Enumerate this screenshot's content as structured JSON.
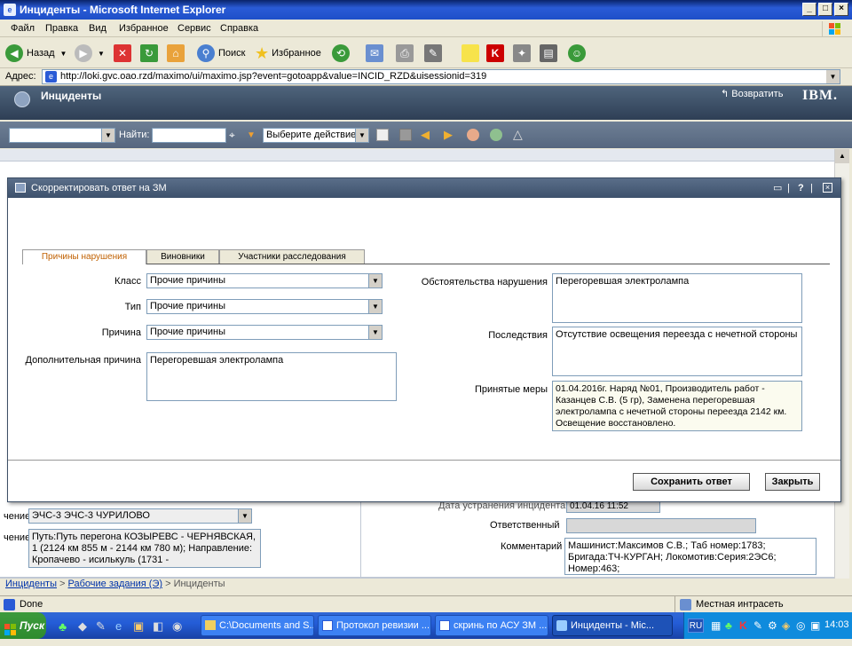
{
  "window": {
    "title": "Инциденты - Microsoft Internet Explorer"
  },
  "menu": [
    "Файл",
    "Правка",
    "Вид",
    "Избранное",
    "Сервис",
    "Справка"
  ],
  "toolbar": {
    "back": "Назад",
    "search": "Поиск",
    "favorites": "Избранное"
  },
  "address": {
    "label": "Адрес:",
    "url": "http://loki.gvc.oao.rzd/maximo/ui/maximo.jsp?event=gotoapp&value=INCID_RZD&uisessionid=319"
  },
  "app": {
    "title": "Инциденты",
    "return_label": "Возвратить",
    "brand": "IBM."
  },
  "apptoolbar": {
    "find_label": "Найти:",
    "action_placeholder": "Выберите действие"
  },
  "dialog": {
    "title": "Скорректировать ответ на ЗМ",
    "tabs": [
      "Причины нарушения",
      "Виновники",
      "Участники расследования"
    ],
    "left": {
      "class_label": "Класс",
      "class_value": "Прочие причины",
      "type_label": "Тип",
      "type_value": "Прочие причины",
      "reason_label": "Причина",
      "reason_value": "Прочие причины",
      "extra_label": "Дополнительная причина",
      "extra_value": "Перегоревшая электролампа"
    },
    "right": {
      "circ_label": "Обстоятельства нарушения",
      "circ_value": "Перегоревшая электролампа",
      "conseq_label": "Последствия",
      "conseq_value": "Отсутствие освещения переезда с нечетной стороны",
      "measures_label": "Принятые меры",
      "measures_value": "01.04.2016г. Наряд №01, Производитель работ - Казанцев С.В. (5 гр), Заменена перегоревшая электролампа с нечетной стороны переезда 2142 км. Освещение восстановлено."
    },
    "save_button": "Сохранить ответ",
    "close_button": "Закрыть"
  },
  "background": {
    "dept_label": "чение:",
    "dept_value": "ЭЧС-3 ЭЧС-3 ЧУРИЛОВО",
    "place_label": "чение:",
    "place_value": "Путь:Путь перегона КОЗЫРЕВС - ЧЕРНЯВСКАЯ, 1 (2124 км 855 м - 2144 км 780 м); Направление: Кропачево - исилькуль (1731 -",
    "repair_date_label": "Дата устранения инцидента",
    "repair_date_value": "01.04.16 11:52",
    "responsible_label": "Ответственный",
    "comment_label": "Комментарий",
    "comment_value": "Машинист:Максимов С.В.; Таб номер:1783; Бригада:ТЧ-КУРГАН; Локомотив:Серия:2ЭС6; Номер:463;"
  },
  "breadcrumb": {
    "first": "Инциденты",
    "second": "Рабочие задания (Э)",
    "third": "Инциденты"
  },
  "status": {
    "left": "Done",
    "zone": "Местная интрасеть"
  },
  "taskbar": {
    "start": "Пуск",
    "tasks": [
      "C:\\Documents and S...",
      "Протокол ревизии ...",
      "скринь по АСУ ЗМ ...",
      "Инциденты - Mic..."
    ],
    "lang": "RU",
    "clock": "14:03"
  }
}
